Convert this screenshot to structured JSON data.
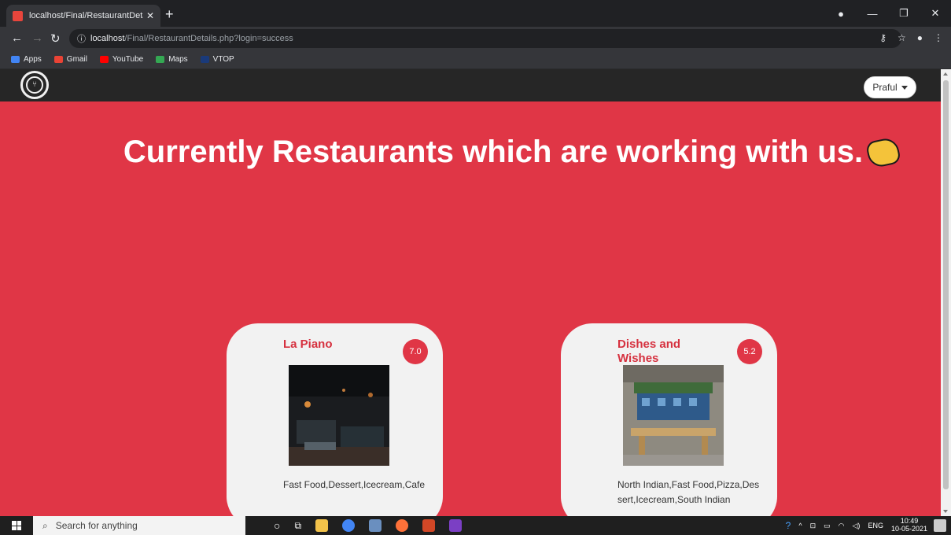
{
  "browser": {
    "tab_title": "localhost/Final/RestaurantDetails",
    "tab_close": "✕",
    "new_tab": "+",
    "url_host": "localhost",
    "url_path": "/Final/RestaurantDetails.php?login=success",
    "bookmarks": [
      {
        "label": "Apps",
        "color": "#4285f4"
      },
      {
        "label": "Gmail",
        "color": "#ea4335"
      },
      {
        "label": "YouTube",
        "color": "#ff0000"
      },
      {
        "label": "Maps",
        "color": "#34a853"
      },
      {
        "label": "VTOP",
        "color": "#1a3a7a"
      }
    ]
  },
  "navbar": {
    "user_label": "Praful"
  },
  "hero": {
    "title": "Currently Restaurants which are working with us."
  },
  "restaurants": [
    {
      "name": "La Piano",
      "rating": "7.0",
      "cuisine": "Fast Food,Dessert,Icecream,Cafe"
    },
    {
      "name": "Dishes and Wishes",
      "rating": "5.2",
      "cuisine": "North Indian,Fast Food,Pizza,Dessert,Icecream,South Indian"
    }
  ],
  "taskbar": {
    "search_placeholder": "Search for anything",
    "lang": "ENG",
    "time": "10:49",
    "date": "10-05-2021"
  },
  "colors": {
    "page_bg": "#e03646",
    "card_bg": "#f2f2f2",
    "accent": "#d6313f",
    "navbar_bg": "#262626"
  }
}
